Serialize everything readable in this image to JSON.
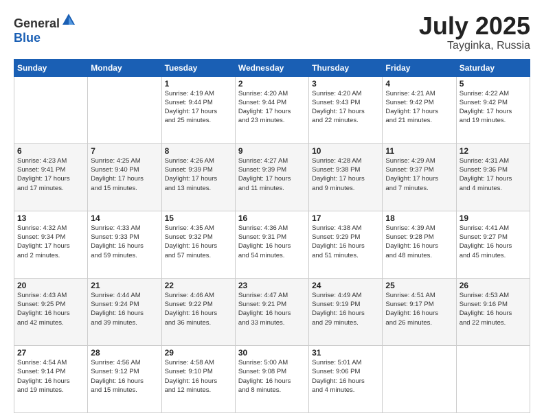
{
  "header": {
    "logo_general": "General",
    "logo_blue": "Blue",
    "month": "July 2025",
    "location": "Tayginka, Russia"
  },
  "weekdays": [
    "Sunday",
    "Monday",
    "Tuesday",
    "Wednesday",
    "Thursday",
    "Friday",
    "Saturday"
  ],
  "weeks": [
    [
      {
        "day": "",
        "info": ""
      },
      {
        "day": "",
        "info": ""
      },
      {
        "day": "1",
        "info": "Sunrise: 4:19 AM\nSunset: 9:44 PM\nDaylight: 17 hours\nand 25 minutes."
      },
      {
        "day": "2",
        "info": "Sunrise: 4:20 AM\nSunset: 9:44 PM\nDaylight: 17 hours\nand 23 minutes."
      },
      {
        "day": "3",
        "info": "Sunrise: 4:20 AM\nSunset: 9:43 PM\nDaylight: 17 hours\nand 22 minutes."
      },
      {
        "day": "4",
        "info": "Sunrise: 4:21 AM\nSunset: 9:42 PM\nDaylight: 17 hours\nand 21 minutes."
      },
      {
        "day": "5",
        "info": "Sunrise: 4:22 AM\nSunset: 9:42 PM\nDaylight: 17 hours\nand 19 minutes."
      }
    ],
    [
      {
        "day": "6",
        "info": "Sunrise: 4:23 AM\nSunset: 9:41 PM\nDaylight: 17 hours\nand 17 minutes."
      },
      {
        "day": "7",
        "info": "Sunrise: 4:25 AM\nSunset: 9:40 PM\nDaylight: 17 hours\nand 15 minutes."
      },
      {
        "day": "8",
        "info": "Sunrise: 4:26 AM\nSunset: 9:39 PM\nDaylight: 17 hours\nand 13 minutes."
      },
      {
        "day": "9",
        "info": "Sunrise: 4:27 AM\nSunset: 9:39 PM\nDaylight: 17 hours\nand 11 minutes."
      },
      {
        "day": "10",
        "info": "Sunrise: 4:28 AM\nSunset: 9:38 PM\nDaylight: 17 hours\nand 9 minutes."
      },
      {
        "day": "11",
        "info": "Sunrise: 4:29 AM\nSunset: 9:37 PM\nDaylight: 17 hours\nand 7 minutes."
      },
      {
        "day": "12",
        "info": "Sunrise: 4:31 AM\nSunset: 9:36 PM\nDaylight: 17 hours\nand 4 minutes."
      }
    ],
    [
      {
        "day": "13",
        "info": "Sunrise: 4:32 AM\nSunset: 9:34 PM\nDaylight: 17 hours\nand 2 minutes."
      },
      {
        "day": "14",
        "info": "Sunrise: 4:33 AM\nSunset: 9:33 PM\nDaylight: 16 hours\nand 59 minutes."
      },
      {
        "day": "15",
        "info": "Sunrise: 4:35 AM\nSunset: 9:32 PM\nDaylight: 16 hours\nand 57 minutes."
      },
      {
        "day": "16",
        "info": "Sunrise: 4:36 AM\nSunset: 9:31 PM\nDaylight: 16 hours\nand 54 minutes."
      },
      {
        "day": "17",
        "info": "Sunrise: 4:38 AM\nSunset: 9:29 PM\nDaylight: 16 hours\nand 51 minutes."
      },
      {
        "day": "18",
        "info": "Sunrise: 4:39 AM\nSunset: 9:28 PM\nDaylight: 16 hours\nand 48 minutes."
      },
      {
        "day": "19",
        "info": "Sunrise: 4:41 AM\nSunset: 9:27 PM\nDaylight: 16 hours\nand 45 minutes."
      }
    ],
    [
      {
        "day": "20",
        "info": "Sunrise: 4:43 AM\nSunset: 9:25 PM\nDaylight: 16 hours\nand 42 minutes."
      },
      {
        "day": "21",
        "info": "Sunrise: 4:44 AM\nSunset: 9:24 PM\nDaylight: 16 hours\nand 39 minutes."
      },
      {
        "day": "22",
        "info": "Sunrise: 4:46 AM\nSunset: 9:22 PM\nDaylight: 16 hours\nand 36 minutes."
      },
      {
        "day": "23",
        "info": "Sunrise: 4:47 AM\nSunset: 9:21 PM\nDaylight: 16 hours\nand 33 minutes."
      },
      {
        "day": "24",
        "info": "Sunrise: 4:49 AM\nSunset: 9:19 PM\nDaylight: 16 hours\nand 29 minutes."
      },
      {
        "day": "25",
        "info": "Sunrise: 4:51 AM\nSunset: 9:17 PM\nDaylight: 16 hours\nand 26 minutes."
      },
      {
        "day": "26",
        "info": "Sunrise: 4:53 AM\nSunset: 9:16 PM\nDaylight: 16 hours\nand 22 minutes."
      }
    ],
    [
      {
        "day": "27",
        "info": "Sunrise: 4:54 AM\nSunset: 9:14 PM\nDaylight: 16 hours\nand 19 minutes."
      },
      {
        "day": "28",
        "info": "Sunrise: 4:56 AM\nSunset: 9:12 PM\nDaylight: 16 hours\nand 15 minutes."
      },
      {
        "day": "29",
        "info": "Sunrise: 4:58 AM\nSunset: 9:10 PM\nDaylight: 16 hours\nand 12 minutes."
      },
      {
        "day": "30",
        "info": "Sunrise: 5:00 AM\nSunset: 9:08 PM\nDaylight: 16 hours\nand 8 minutes."
      },
      {
        "day": "31",
        "info": "Sunrise: 5:01 AM\nSunset: 9:06 PM\nDaylight: 16 hours\nand 4 minutes."
      },
      {
        "day": "",
        "info": ""
      },
      {
        "day": "",
        "info": ""
      }
    ]
  ]
}
